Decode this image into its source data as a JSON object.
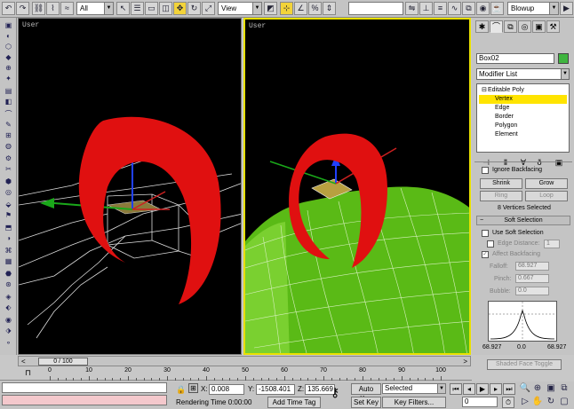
{
  "toolbar": {
    "filter_value": "All",
    "refcoord_value": "View",
    "named_selection_value": "Blowup",
    "icons": [
      "undo-icon",
      "redo-icon",
      "link-icon",
      "unlink-icon",
      "bind-space-warp-icon",
      "select-icon",
      "select-by-name-icon",
      "rect-selection-icon",
      "window-crossing-icon",
      "move-icon",
      "rotate-icon",
      "scale-icon",
      "pivot-icon",
      "snap-icon",
      "angle-snap-icon",
      "percent-snap-icon",
      "spinner-snap-icon",
      "named-sets-icon",
      "mirror-icon",
      "align-icon",
      "layer-icon",
      "curve-editor-icon",
      "schematic-icon",
      "material-editor-icon",
      "render-icon"
    ]
  },
  "viewports": {
    "left_label": "User",
    "right_label": "User"
  },
  "command_panel": {
    "tabs": [
      "create-tab",
      "modify-tab",
      "hierarchy-tab",
      "motion-tab",
      "display-tab",
      "utilities-tab"
    ],
    "object_name": "Box02",
    "object_color": "#3fb53f",
    "modifier_list_label": "Modifier List",
    "stack": [
      {
        "label": "Editable Poly",
        "level": 0,
        "selected": false
      },
      {
        "label": "Vertex",
        "level": 1,
        "selected": true
      },
      {
        "label": "Edge",
        "level": 1,
        "selected": false
      },
      {
        "label": "Border",
        "level": 1,
        "selected": false
      },
      {
        "label": "Polygon",
        "level": 1,
        "selected": false
      },
      {
        "label": "Element",
        "level": 1,
        "selected": false
      }
    ],
    "selection": {
      "ignore_backfacing_label": "Ignore Backfacing",
      "shrink_label": "Shrink",
      "grow_label": "Grow",
      "ring_label": "Ring",
      "loop_label": "Loop",
      "status_text": "8 Vertices Selected"
    },
    "soft_selection": {
      "header_label": "Soft Selection",
      "use_soft_selection_label": "Use Soft Selection",
      "edge_distance_label": "Edge Distance:",
      "edge_distance_value": "1",
      "affect_backfacing_label": "Affect Backfacing",
      "falloff_label": "Falloff:",
      "falloff_value": "68.927",
      "pinch_label": "Pinch:",
      "pinch_value": "0.667",
      "bubble_label": "Bubble:",
      "bubble_value": "0.0",
      "curve_left_value": "68.927",
      "curve_mid_value": "0.0",
      "curve_right_value": "68.927",
      "shaded_face_toggle_label": "Shaded Face Toggle"
    }
  },
  "timeline": {
    "slider_label": "0 / 100",
    "ticks": [
      "0",
      "10",
      "20",
      "30",
      "40",
      "50",
      "60",
      "70",
      "80",
      "90",
      "100"
    ]
  },
  "status": {
    "x_label": "X:",
    "x_value": "0.008",
    "y_label": "Y:",
    "y_value": "-1508.401",
    "z_label": "Z:",
    "z_value": "135.669",
    "rendering_time_label": "Rendering Time  0:00:00",
    "add_time_tag_label": "Add Time Tag",
    "auto_key_label": "Auto Key",
    "set_key_label": "Set Key",
    "key_mode_value": "Selected",
    "key_filters_label": "Key Filters...",
    "current_frame_value": "0"
  }
}
